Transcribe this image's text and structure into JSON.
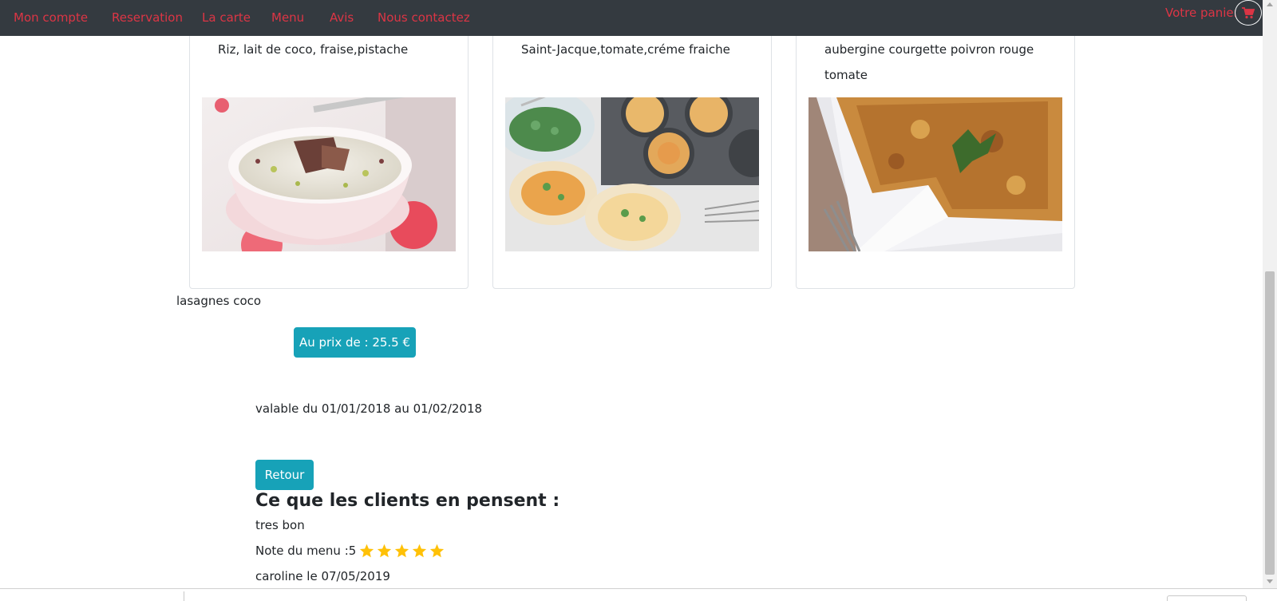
{
  "nav": {
    "items": [
      {
        "label": "Mon compte"
      },
      {
        "label": "Reservation"
      },
      {
        "label": "La carte"
      },
      {
        "label": "Menu"
      },
      {
        "label": "Avis"
      },
      {
        "label": "Nous contactez"
      }
    ],
    "cart_label": "Votre panier",
    "cart_icon": "shopping-cart-icon"
  },
  "cards": [
    {
      "ingredients": "Riz, lait de coco, fraise,pistache",
      "image": "rice-pudding-photo"
    },
    {
      "ingredients": "Saint-Jacque,tomate,créme fraiche",
      "image": "mini-quiche-photo"
    },
    {
      "ingredients": "aubergine courgette poivron rouge tomate",
      "image": "vegetable-gratin-photo"
    }
  ],
  "menu": {
    "name": "lasagnes coco",
    "price_label": "Au prix de : 25.5 €",
    "validity": "valable du 01/01/2018 au 01/02/2018",
    "back_label": "Retour"
  },
  "reviews": {
    "title": "Ce que les clients en pensent :",
    "items": [
      {
        "text": "tres bon",
        "rating_label": "Note du menu :5",
        "rating": 5,
        "author": "caroline le 07/05/2019"
      }
    ]
  },
  "colors": {
    "navbar": "#343a40",
    "nav_link": "#dc3545",
    "button": "#17a2b8",
    "star": "#ffc107"
  }
}
